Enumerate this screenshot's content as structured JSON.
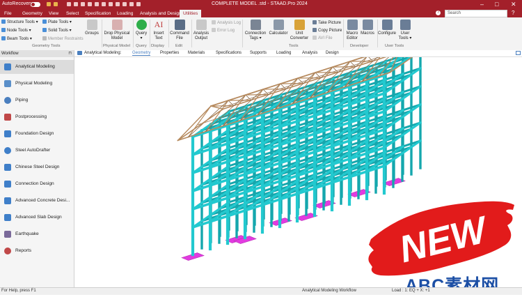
{
  "title_bar": {
    "autorecovery_label": "AutoRecovery",
    "toggle_state": "Off",
    "window_title": "COMPLETE MODEL .std - STAAD.Pro 2024",
    "minimize_glyph": "–",
    "maximize_glyph": "□",
    "close_glyph": "✕"
  },
  "menu": {
    "items": [
      "File",
      "Geometry",
      "View",
      "Select",
      "Specification",
      "Loading",
      "Analysis and Design",
      "Utilities"
    ],
    "active": "Utilities",
    "search_placeholder": "Search"
  },
  "ribbon": {
    "geometry_tools": {
      "label": "Geometry Tools",
      "items": [
        "Structure Tools",
        "Node Tools",
        "Beam Tools",
        "Plate Tools",
        "Solid Tools",
        "Member Restraints"
      ]
    },
    "groups_label": "Groups",
    "physical_model": {
      "label": "Physical Model",
      "button": "Drop Physical Model"
    },
    "query": {
      "label": "Query",
      "button": "Query"
    },
    "display": {
      "label": "Display",
      "button": "Insert Text"
    },
    "edit": {
      "label": "Edit",
      "button": "Command File"
    },
    "analysis": {
      "analysis_output": "Analysis Output",
      "analysis_log": "Analysis Log",
      "error_log": "Error Log"
    },
    "tools": {
      "label": "Tools",
      "connection_tags": "Connection Tags",
      "calculator": "Calculator",
      "unit_converter": "Unit Converter",
      "take_picture": "Take Picture",
      "copy_picture": "Copy Picture",
      "avi_file": "AVI File"
    },
    "developer": {
      "label": "Developer",
      "macro_editor": "Macro Editor",
      "macros": "Macros"
    },
    "user_tools": {
      "label": "User Tools",
      "configure": "Configure",
      "user_tools": "User Tools"
    }
  },
  "sidebar": {
    "header": "Workflow",
    "active": "Analytical Modeling",
    "items": [
      "Analytical Modeling",
      "Physical Modeling",
      "Piping",
      "Postprocessing",
      "Foundation Design",
      "Steel AutoDrafter",
      "Chinese Steel Design",
      "Connection Design",
      "Advanced Concrete Desi...",
      "Advanced Slab Design",
      "Earthquake",
      "Reports"
    ]
  },
  "page_tabs": {
    "prefix": "Analytical Modeling:",
    "items": [
      "Geometry",
      "Properties",
      "Materials",
      "Specifications",
      "Supports",
      "Loading",
      "Analysis",
      "Design"
    ],
    "active": "Geometry"
  },
  "overlay": {
    "badge_text": "NEW",
    "watermark_text": "ABC素材网"
  },
  "status_bar": {
    "help": "For Help, press F1",
    "workflow": "Analytical Modeling Workflow",
    "load": "Load : 1: EQ + X: +1"
  },
  "colors": {
    "brand_red": "#a3202a",
    "frame_cyan": "#22c9cf",
    "footing_magenta": "#e23be0",
    "roof_brown": "#b68a5e",
    "badge_red": "#e21b1b",
    "watermark_blue": "#1c4fa5"
  }
}
